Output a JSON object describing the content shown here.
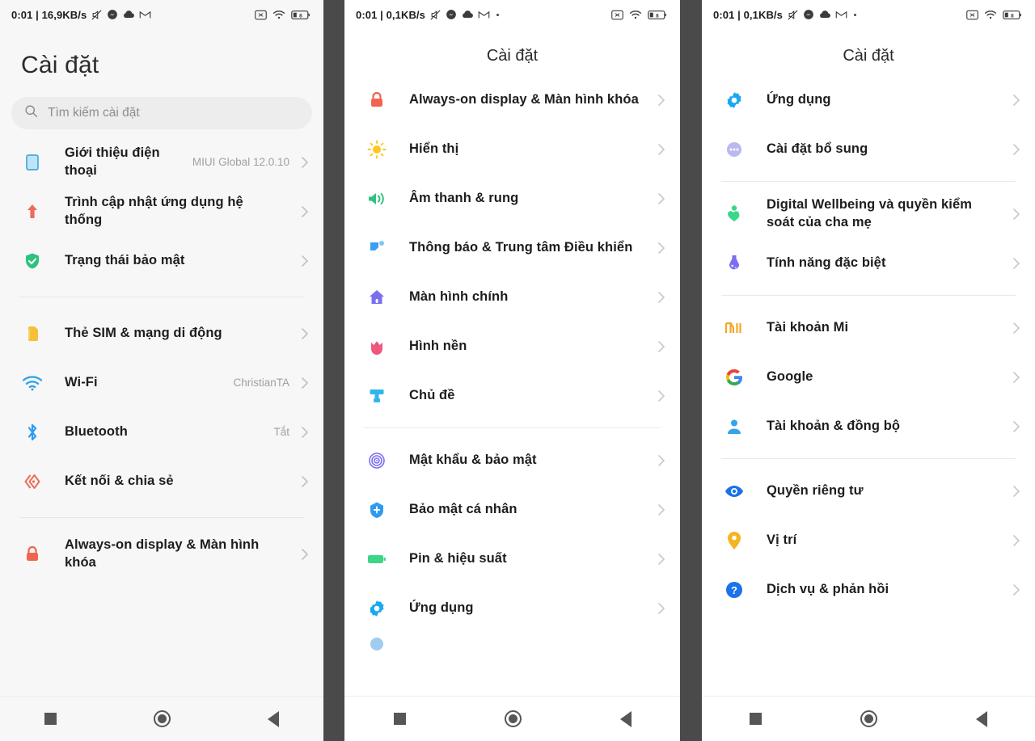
{
  "statusbars": {
    "p1": {
      "time": "0:01",
      "sep": "|",
      "netspeed": "16,9KB/s",
      "icons": [
        "mute-icon",
        "messenger-icon",
        "cloud-icon",
        "gmail-icon"
      ],
      "right_icons": [
        "cast-off-icon",
        "wifi-icon",
        "battery-icon"
      ],
      "battery_level": "8",
      "has_trailing_dot": false
    },
    "p2": {
      "time": "0:01",
      "sep": "|",
      "netspeed": "0,1KB/s",
      "icons": [
        "mute-icon",
        "messenger-icon",
        "cloud-icon",
        "gmail-icon"
      ],
      "right_icons": [
        "cast-off-icon",
        "wifi-icon",
        "battery-icon"
      ],
      "battery_level": "8",
      "has_trailing_dot": true
    },
    "p3": {
      "time": "0:01",
      "sep": "|",
      "netspeed": "0,1KB/s",
      "icons": [
        "mute-icon",
        "messenger-icon",
        "cloud-icon",
        "gmail-icon"
      ],
      "right_icons": [
        "cast-off-icon",
        "wifi-icon",
        "battery-icon"
      ],
      "battery_level": "8",
      "has_trailing_dot": true
    }
  },
  "panel1": {
    "title": "Cài đặt",
    "search": {
      "placeholder": "Tìm kiếm cài đặt",
      "icon": "search-icon"
    },
    "rows": [
      {
        "icon": "phone-about-icon",
        "color": "#7ec8f0",
        "label": "Giới thiệu điện thoại",
        "value": "MIUI Global 12.0.10"
      },
      {
        "icon": "system-update-arrow-icon",
        "color": "#ef6b5a",
        "label": "Trình cập nhật ứng dụng hệ thống",
        "value": ""
      },
      {
        "icon": "security-shield-icon",
        "color": "#2ec27e",
        "label": "Trạng thái bảo mật",
        "value": ""
      },
      {
        "divider": true
      },
      {
        "icon": "sim-card-icon",
        "color": "#f5c038",
        "label": "Thẻ SIM & mạng di động",
        "value": ""
      },
      {
        "icon": "wifi-icon",
        "color": "#35a3e8",
        "label": "Wi-Fi",
        "value": "ChristianTA"
      },
      {
        "icon": "bluetooth-icon",
        "color": "#2f9bf0",
        "label": "Bluetooth",
        "value": "Tắt"
      },
      {
        "icon": "connection-share-icon",
        "color": "#ef6b5a",
        "label": "Kết nối & chia sẻ",
        "value": ""
      },
      {
        "divider": true
      },
      {
        "icon": "lock-icon",
        "color": "#f1654f",
        "label": "Always-on display & Màn hình khóa",
        "value": ""
      }
    ]
  },
  "panel2": {
    "title": "Cài đặt",
    "rows": [
      {
        "icon": "lock-icon",
        "color": "#f1654f",
        "label": "Always-on display & Màn hình khóa",
        "value": ""
      },
      {
        "icon": "brightness-sun-icon",
        "color": "#fcc81f",
        "label": "Hiển thị",
        "value": ""
      },
      {
        "icon": "sound-speaker-icon",
        "color": "#2ec27e",
        "label": "Âm thanh & rung",
        "value": ""
      },
      {
        "icon": "notification-icon",
        "color": "#3b9ef0",
        "label": "Thông báo & Trung tâm Điều khiển",
        "value": ""
      },
      {
        "icon": "home-screen-icon",
        "color": "#7b6ef0",
        "label": "Màn hình chính",
        "value": ""
      },
      {
        "icon": "wallpaper-flower-icon",
        "color": "#f0587f",
        "label": "Hình nền",
        "value": ""
      },
      {
        "icon": "themes-icon",
        "color": "#2fb6ea",
        "label": "Chủ đề",
        "value": ""
      },
      {
        "divider": true
      },
      {
        "icon": "fingerprint-icon",
        "color": "#7b6ef0",
        "label": "Mật khẩu & bảo mật",
        "value": ""
      },
      {
        "icon": "privacy-protection-icon",
        "color": "#2f9bf0",
        "label": "Bảo mật cá nhân",
        "value": ""
      },
      {
        "icon": "battery-icon",
        "color": "#3cd68a",
        "label": "Pin & hiệu suất",
        "value": ""
      },
      {
        "icon": "apps-gear-icon",
        "color": "#1aa9f0",
        "label": "Ứng dụng",
        "value": ""
      }
    ],
    "partial_row_icon": "partial-blue-icon"
  },
  "panel3": {
    "title": "Cài đặt",
    "rows": [
      {
        "icon": "apps-gear-icon",
        "color": "#1aa9f0",
        "label": "Ứng dụng",
        "value": ""
      },
      {
        "icon": "additional-settings-icon",
        "color": "#8c8ce8",
        "label": "Cài đặt bổ sung",
        "value": ""
      },
      {
        "divider": true
      },
      {
        "icon": "digital-wellbeing-icon",
        "color": "#3cd68a",
        "label": "Digital Wellbeing và quyền kiểm soát của cha mẹ",
        "value": ""
      },
      {
        "icon": "special-features-icon",
        "color": "#7b6ef0",
        "label": "Tính năng đặc biệt",
        "value": ""
      },
      {
        "divider": true
      },
      {
        "icon": "mi-account-icon",
        "color": "#f5a623",
        "label": "Tài khoản Mi",
        "value": ""
      },
      {
        "icon": "google-icon",
        "color": "#4285f4",
        "label": "Google",
        "value": ""
      },
      {
        "icon": "accounts-sync-icon",
        "color": "#35a3e8",
        "label": "Tài khoản & đồng bộ",
        "value": ""
      },
      {
        "divider": true
      },
      {
        "icon": "privacy-eye-icon",
        "color": "#1a73e8",
        "label": "Quyền riêng tư",
        "value": ""
      },
      {
        "icon": "location-pin-icon",
        "color": "#f5b521",
        "label": "Vị trí",
        "value": ""
      },
      {
        "icon": "help-feedback-icon",
        "color": "#1a73e8",
        "label": "Dịch vụ & phản hồi",
        "value": ""
      }
    ]
  },
  "navbar": {
    "recents": "recents-square-icon",
    "home": "home-circle-icon",
    "back": "back-triangle-icon"
  }
}
